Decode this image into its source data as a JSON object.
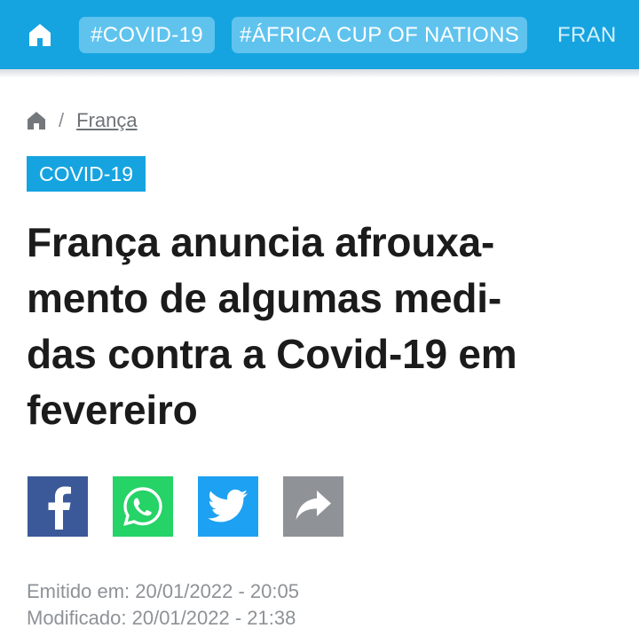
{
  "topbar": {
    "home_icon": "home-icon",
    "tags": [
      "#COVID-19",
      "#ÁFRICA CUP OF NATIONS",
      "FRAN"
    ]
  },
  "breadcrumb": {
    "home_icon": "home-icon",
    "separator": "/",
    "current": "França"
  },
  "category_tag": "COVID-19",
  "headline": {
    "lines": [
      "França anuncia afrouxa-",
      "mento de algumas medi-",
      "das contra a Covid-19 em",
      "fevereiro"
    ]
  },
  "share": {
    "icons": [
      "facebook-icon",
      "whatsapp-icon",
      "twitter-icon",
      "share-arrow-icon"
    ]
  },
  "meta": {
    "issued": "Emitido em: 20/01/2022 - 20:05",
    "modified": "Modificado: 20/01/2022 - 21:38"
  },
  "colors": {
    "brand_blue": "#16a4e0",
    "pill_blue": "#5fc3ee",
    "facebook": "#3b5998",
    "whatsapp": "#25d366",
    "twitter": "#1da1f2",
    "share_gray": "#8f9296"
  }
}
